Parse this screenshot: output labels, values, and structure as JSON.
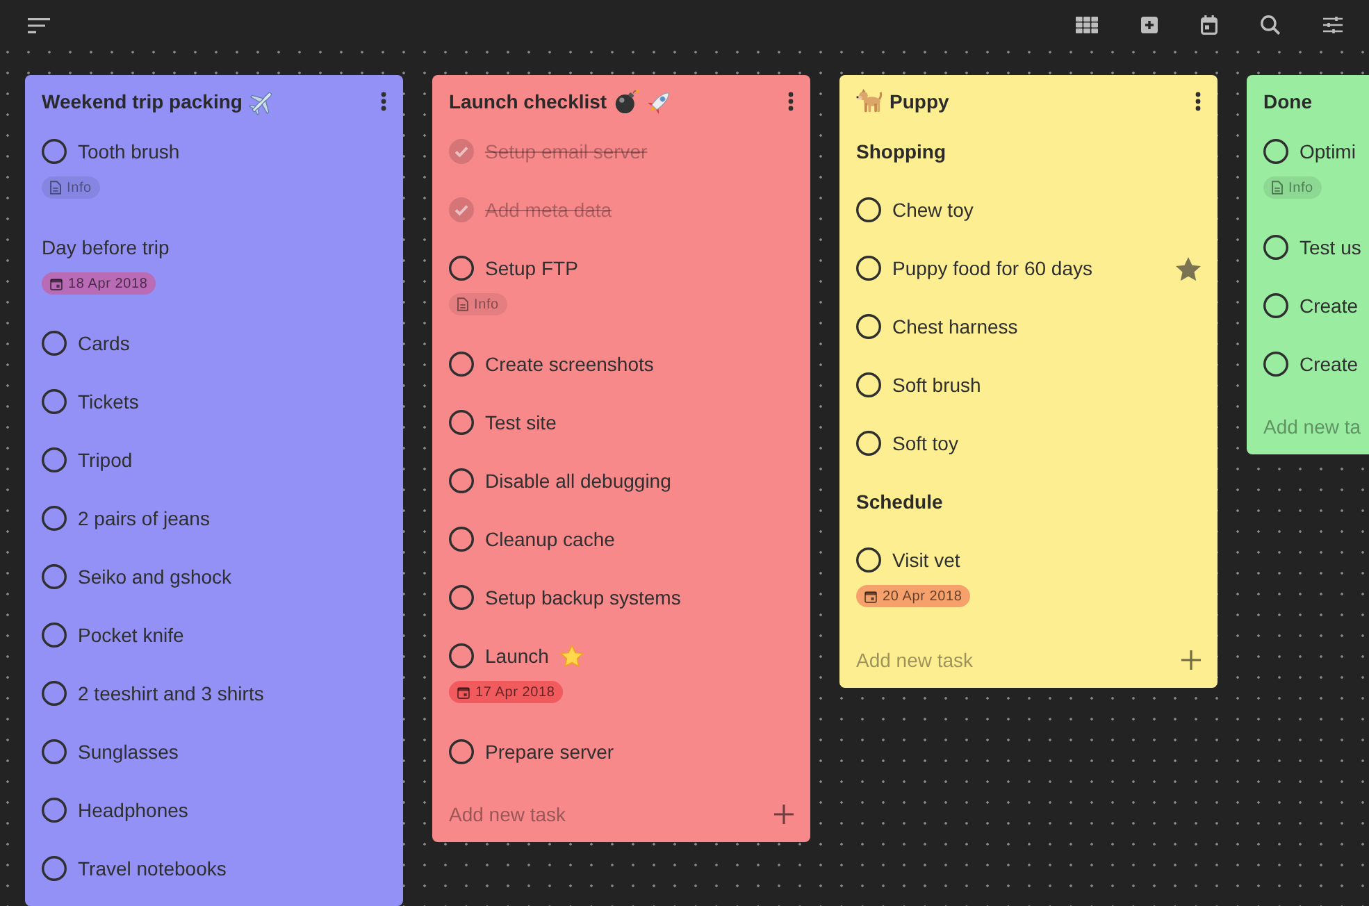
{
  "columns": [
    {
      "header": [
        {
          "kind": "text",
          "text": "Weekend trip packing"
        },
        {
          "kind": "airplane"
        }
      ],
      "color": "#9391f6",
      "menu": true,
      "items": [
        {
          "kind": "task",
          "text": "Tooth brush",
          "checked": false,
          "badge": {
            "kind": "info",
            "text": "Info"
          }
        },
        {
          "kind": "note",
          "text": "Day before trip",
          "badge": {
            "kind": "date",
            "text": "18 Apr 2018",
            "color": "#b96bb5"
          }
        },
        {
          "kind": "task",
          "text": "Cards",
          "checked": false
        },
        {
          "kind": "task",
          "text": "Tickets",
          "checked": false
        },
        {
          "kind": "task",
          "text": "Tripod",
          "checked": false
        },
        {
          "kind": "task",
          "text": "2 pairs of jeans",
          "checked": false
        },
        {
          "kind": "task",
          "text": "Seiko and gshock",
          "checked": false
        },
        {
          "kind": "task",
          "text": "Pocket knife",
          "checked": false
        },
        {
          "kind": "task",
          "text": "2 teeshirt and 3 shirts",
          "checked": false
        },
        {
          "kind": "task",
          "text": "Sunglasses",
          "checked": false
        },
        {
          "kind": "task",
          "text": "Headphones",
          "checked": false
        },
        {
          "kind": "task",
          "text": "Travel notebooks",
          "checked": false
        }
      ]
    },
    {
      "header": [
        {
          "kind": "text",
          "text": "Launch checklist"
        },
        {
          "kind": "bomb"
        },
        {
          "kind": "rocket"
        }
      ],
      "color": "#f8898b",
      "menu": true,
      "items": [
        {
          "kind": "task",
          "text": "Setup email server",
          "checked": true
        },
        {
          "kind": "task",
          "text": "Add meta data",
          "checked": true
        },
        {
          "kind": "task",
          "text": "Setup FTP",
          "checked": false,
          "badge": {
            "kind": "info",
            "text": "Info"
          }
        },
        {
          "kind": "task",
          "text": "Create screenshots",
          "checked": false
        },
        {
          "kind": "task",
          "text": "Test site",
          "checked": false
        },
        {
          "kind": "task",
          "text": "Disable all debugging",
          "checked": false
        },
        {
          "kind": "task",
          "text": "Cleanup cache",
          "checked": false
        },
        {
          "kind": "task",
          "text": "Setup backup systems",
          "checked": false
        },
        {
          "kind": "task",
          "text": "Launch",
          "checked": false,
          "emoji": {
            "kind": "star"
          },
          "badge": {
            "kind": "date",
            "text": "17 Apr 2018",
            "color": "#f25b5e"
          }
        },
        {
          "kind": "task",
          "text": "Prepare server",
          "checked": false
        }
      ],
      "add_task": {
        "placeholder": "Add new task",
        "plus": true
      }
    },
    {
      "header": [
        {
          "kind": "dog"
        },
        {
          "kind": "text",
          "text": "Puppy"
        }
      ],
      "color": "#fdee92",
      "menu": true,
      "items": [
        {
          "kind": "heading",
          "text": "Shopping"
        },
        {
          "kind": "task",
          "text": "Chew toy",
          "checked": false,
          "starred": false
        },
        {
          "kind": "task",
          "text": "Puppy food for 60 days",
          "checked": false,
          "starred": true
        },
        {
          "kind": "task",
          "text": "Chest harness",
          "checked": false,
          "starred": false
        },
        {
          "kind": "task",
          "text": "Soft brush",
          "checked": false,
          "starred": false
        },
        {
          "kind": "task",
          "text": "Soft toy",
          "checked": false,
          "starred": false
        },
        {
          "kind": "heading",
          "text": "Schedule"
        },
        {
          "kind": "task",
          "text": "Visit vet",
          "checked": false,
          "starred": false,
          "badge": {
            "kind": "date",
            "text": "20 Apr 2018",
            "color": "#f6a16b"
          }
        }
      ],
      "add_task": {
        "placeholder": "Add new task",
        "plus": true
      }
    },
    {
      "header": [
        {
          "kind": "text",
          "text": "Done"
        }
      ],
      "color": "#9aeca0",
      "menu": false,
      "items": [
        {
          "kind": "task",
          "text": "Optimi",
          "checked": false,
          "badge": {
            "kind": "info",
            "text": "Info"
          }
        },
        {
          "kind": "task",
          "text": "Test us",
          "checked": false
        },
        {
          "kind": "task",
          "text": "Create",
          "checked": false
        },
        {
          "kind": "task",
          "text": "Create",
          "checked": false
        }
      ],
      "add_task": {
        "placeholder": "Add new ta",
        "plus": false
      }
    }
  ]
}
